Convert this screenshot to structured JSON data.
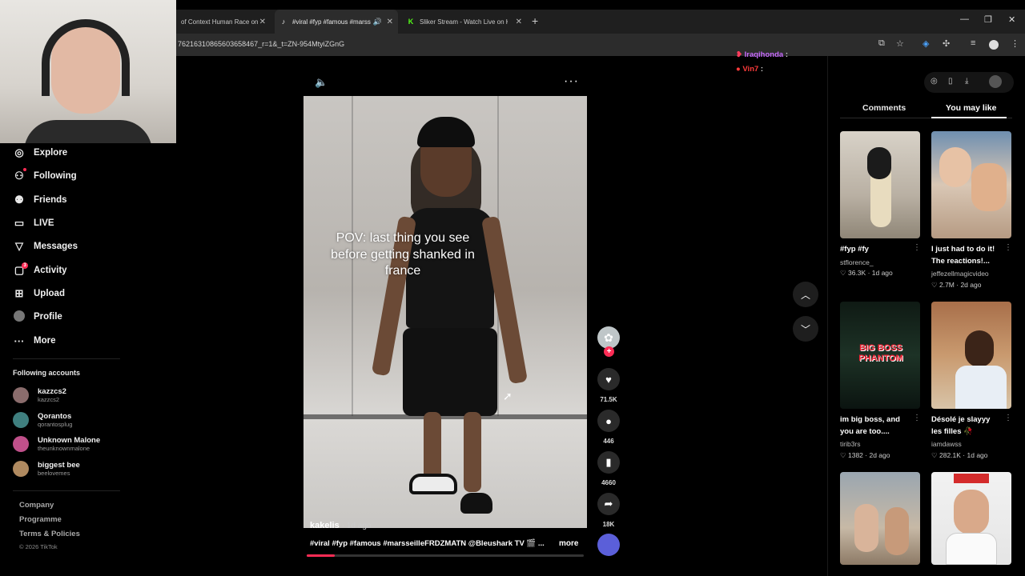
{
  "browser": {
    "tabs": [
      {
        "title": "of Context Human Race on"
      },
      {
        "title": "#viral #fyp #famous #marss"
      },
      {
        "title": "Sliker Stream - Watch Live on K"
      }
    ],
    "url": "76216310865603658467_r=1&_t=ZN-954MtyiZGnG"
  },
  "nav": {
    "items": [
      {
        "label": "Explore",
        "icon": "compass-icon"
      },
      {
        "label": "Following",
        "icon": "following-icon"
      },
      {
        "label": "Friends",
        "icon": "friends-icon"
      },
      {
        "label": "LIVE",
        "icon": "live-icon"
      },
      {
        "label": "Messages",
        "icon": "messages-icon"
      },
      {
        "label": "Activity",
        "icon": "activity-icon",
        "badge": "3"
      },
      {
        "label": "Upload",
        "icon": "upload-icon"
      },
      {
        "label": "Profile",
        "icon": "profile-icon"
      },
      {
        "label": "More",
        "icon": "more-icon"
      }
    ],
    "following_title": "Following accounts",
    "accounts": [
      {
        "name": "kazzcs2",
        "handle": "kazzcs2"
      },
      {
        "name": "Qorantos",
        "handle": "qorantosplug"
      },
      {
        "name": "Unknown Malone",
        "handle": "theunknownmalone"
      },
      {
        "name": "biggest bee",
        "handle": "beelovemes"
      }
    ],
    "footer": {
      "company": "Company",
      "programme": "Programme",
      "terms": "Terms & Policies",
      "copyright": "© 2026 TikTok"
    }
  },
  "video": {
    "caption_lines": [
      "POV: last thing you see",
      "before getting shanked in",
      "france"
    ],
    "author": "kakelis",
    "time_ago": "· 1d ago",
    "description": "#viral #fyp #famous #marsseilleFRDZMATN @Bleushark TV 🎬 ...",
    "more_label": "more",
    "progress": 0.1
  },
  "actions": {
    "likes": "71.5K",
    "comments": "446",
    "saves": "4660",
    "shares": "18K"
  },
  "chat": [
    {
      "user": "Iraqihonda",
      "text": ":",
      "color": "#c86bff"
    },
    {
      "user": "Vin7",
      "text": ":",
      "color": "#ff3b3b"
    }
  ],
  "panel": {
    "tab_comments": "Comments",
    "tab_you_may_like": "You may like",
    "cards": [
      {
        "title_1": "#fyp #fy",
        "title_2": "",
        "user": "stflorence_",
        "likes": "36.3K",
        "ago": "1d ago"
      },
      {
        "title_1": "I just had to do it!",
        "title_2": "The reactions!...",
        "user": "jeffezellmagicvideo",
        "likes": "2.7M",
        "ago": "2d ago"
      },
      {
        "title_1": "im big boss, and",
        "title_2": "you are too....",
        "user": "tirib3rs",
        "likes": "1382",
        "ago": "2d ago"
      },
      {
        "title_1": "Désolé je slayyy",
        "title_2": "les filles 🥀",
        "user": "iamdawss",
        "likes": "282.1K",
        "ago": "1d ago"
      }
    ],
    "card3_overlay": "BIG BOSS PHANTOM"
  },
  "colors": {
    "accent": "#fe2c55"
  }
}
